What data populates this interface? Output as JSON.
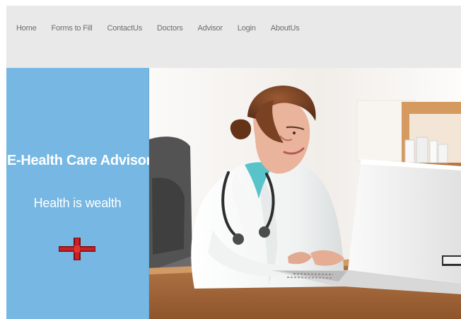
{
  "nav": {
    "items": [
      {
        "label": "Home"
      },
      {
        "label": "Forms to Fill"
      },
      {
        "label": "ContactUs"
      },
      {
        "label": "Doctors"
      },
      {
        "label": "Advisor"
      },
      {
        "label": "Login"
      },
      {
        "label": "AboutUs"
      }
    ]
  },
  "hero": {
    "title": "E-Health Care  Advisor",
    "tagline": "Health is wealth",
    "cross_icon": "medical-cross-icon",
    "image_subject": "doctor-using-laptop-photo"
  },
  "colors": {
    "nav_background": "#e9e9e9",
    "nav_text": "#6d6d6d",
    "sidebar_background": "#76b7e3",
    "sidebar_text": "#ffffff",
    "cross_red": "#c91f25",
    "cross_dark_red": "#7c0f12"
  }
}
